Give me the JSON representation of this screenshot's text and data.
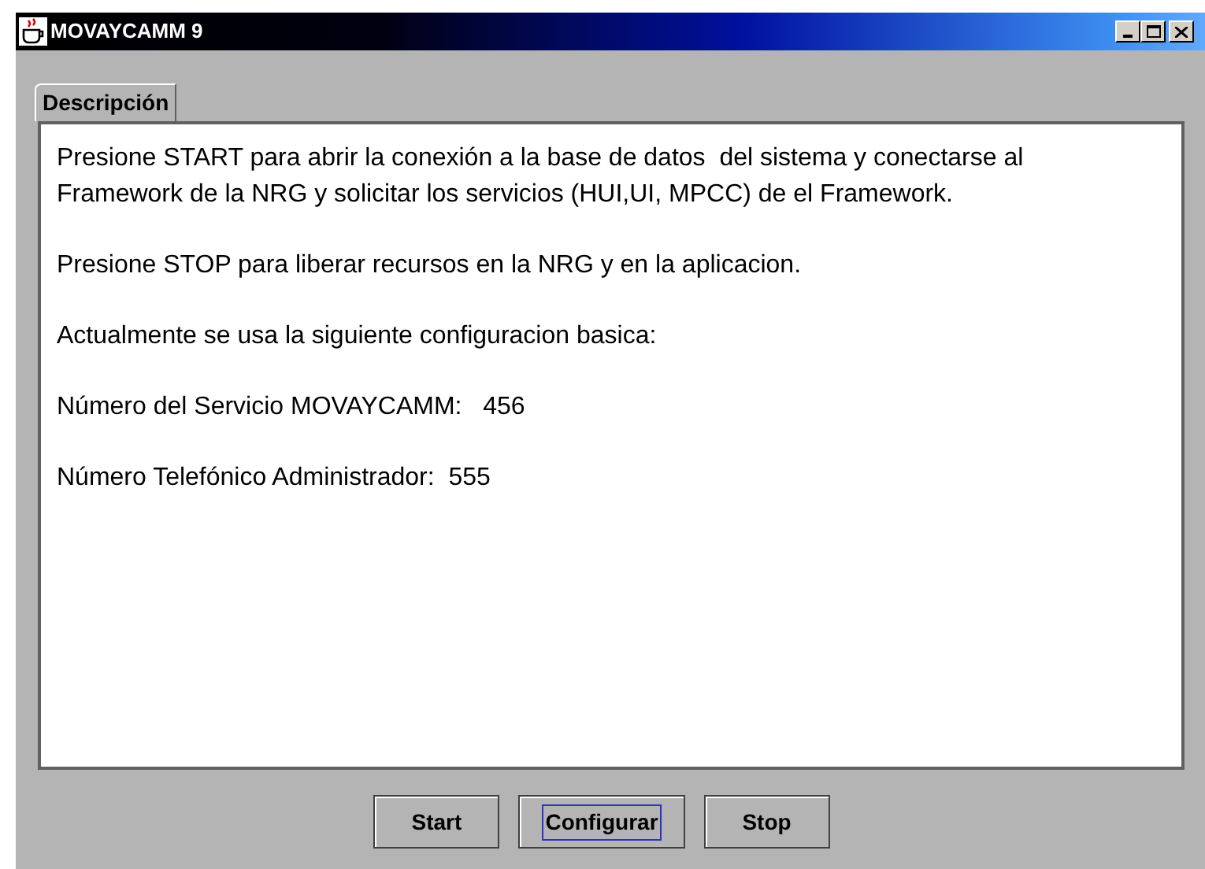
{
  "window": {
    "title": "MOVAYCAMM 9"
  },
  "tabs": [
    {
      "label": "Descripción",
      "selected": true
    }
  ],
  "description": {
    "paragraphs": [
      [
        "Presione START para abrir la conexión a la base de datos  del sistema y conectarse al",
        "Framework de la NRG y solicitar los servicios (HUI,UI, MPCC) de el Framework."
      ],
      [
        "Presione STOP para liberar recursos en la NRG y en la aplicacion."
      ],
      [
        "Actualmente se usa la siguiente configuracion basica:"
      ],
      [
        "Número del Servicio MOVAYCAMM:   456"
      ],
      [
        "Número Telefónico Administrador:  555"
      ]
    ]
  },
  "buttons": [
    {
      "label": "Start",
      "focused": false
    },
    {
      "label": "Configurar",
      "focused": true
    },
    {
      "label": "Stop",
      "focused": false
    }
  ]
}
